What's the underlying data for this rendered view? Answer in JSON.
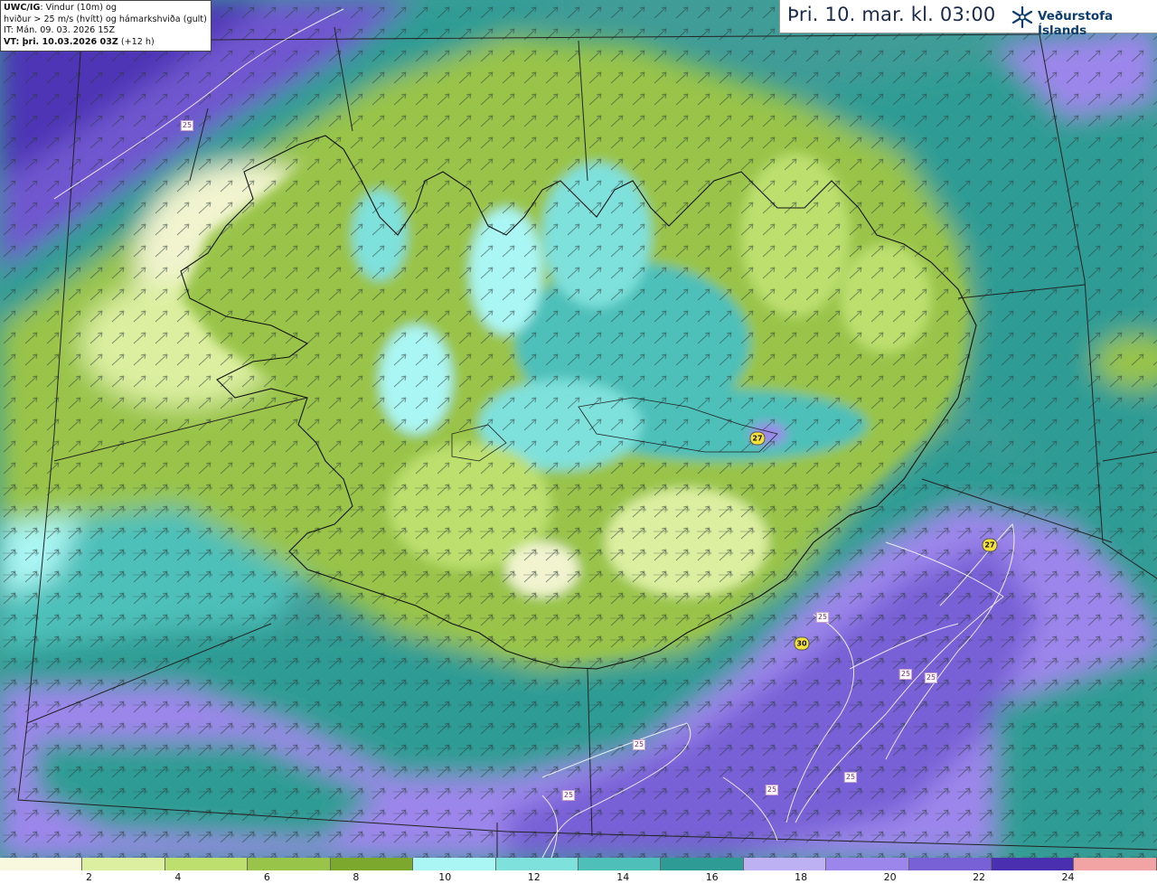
{
  "info": {
    "line1_bold": "UWC/IG",
    "line1_rest": ": Vindur (10m) og",
    "line2": "hviður > 25 m/s (hvítt) og hámarkshviða (gult)",
    "line3": "IT: Mán. 09. 03. 2026 15Z",
    "line4_bold": "VT: þri. 10.03.2026 03Z",
    "line4_rest": " (+12 h)"
  },
  "header": {
    "title": "Þri. 10. mar. kl. 03:00",
    "brand": "Veðurstofa Íslands"
  },
  "legend": {
    "colors": [
      "#f7f8de",
      "#dcefa0",
      "#bcdf6e",
      "#99c44a",
      "#7ca82e",
      "#aaf6f4",
      "#7fe1dc",
      "#4ec0b9",
      "#2e9c94",
      "#bdb0f3",
      "#9c86eb",
      "#7860d6",
      "#4a2fb0",
      "#f2a4a4"
    ],
    "ticks": [
      "2",
      "4",
      "6",
      "8",
      "10",
      "12",
      "14",
      "16",
      "18",
      "20",
      "22",
      "24"
    ]
  },
  "gust_labels": [
    "27",
    "27",
    "30"
  ],
  "contour_labels": [
    "25",
    "25",
    "25",
    "25",
    "25",
    "25",
    "25",
    "25",
    "25"
  ]
}
